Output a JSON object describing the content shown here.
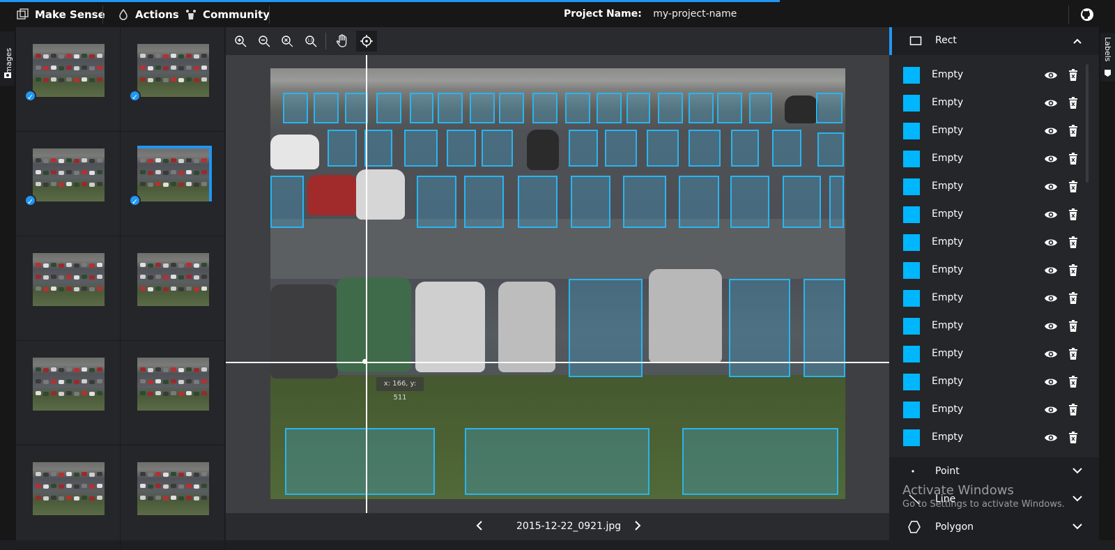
{
  "topbar": {
    "brand": "Make Sense",
    "actions": "Actions",
    "community": "Community",
    "project_label": "Project Name:",
    "project_value": "my-project-name"
  },
  "left_tab": {
    "label": "Images"
  },
  "right_tab": {
    "label": "Labels"
  },
  "toolbar": {
    "tools": [
      "zoom-in-icon",
      "zoom-out-icon",
      "zoom-fit-icon",
      "zoom-reset-icon",
      "hand-icon",
      "crosshair-icon"
    ],
    "active_tool": "crosshair-icon"
  },
  "editor": {
    "cursor_readout": "x: 166, y: 511",
    "filename": "2015-12-22_0921.jpg"
  },
  "labels_panel": {
    "active_section": "Rect",
    "rect_labels": [
      "Empty",
      "Empty",
      "Empty",
      "Empty",
      "Empty",
      "Empty",
      "Empty",
      "Empty",
      "Empty",
      "Empty",
      "Empty",
      "Empty",
      "Empty",
      "Empty"
    ],
    "label_color": "#00b7ff",
    "sections": [
      "Point",
      "Line",
      "Polygon"
    ]
  },
  "watermark": {
    "line1": "Activate Windows",
    "line2": "Go to Settings to activate Windows."
  },
  "colors": {
    "accent": "#2196f3",
    "bbox": "#2ab4f0"
  }
}
